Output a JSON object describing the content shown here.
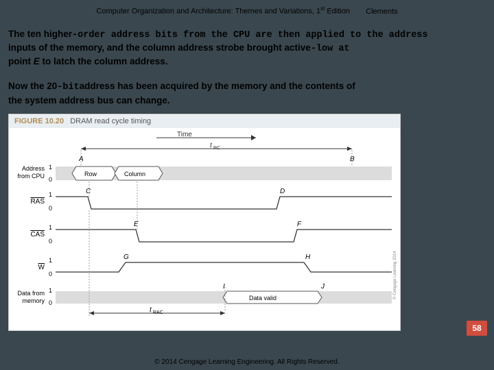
{
  "header": {
    "title_left": "Computer Organization and Architecture: Themes and Variations, 1",
    "title_sup": "st",
    "title_right": " Edition",
    "author": "Clements"
  },
  "para1": {
    "t1": "The ten higher",
    "t2": "-order address bits from the CPU are then applied to the address",
    "t3": "inputs of the memory, and the column address strobe brought active",
    "t4": "-low at",
    "t5": "point ",
    "t6": "E",
    "t7": " to latch the column address."
  },
  "para2": {
    "t1": "Now the 20",
    "t2": "-bit",
    "t3": "address has been acquired by the memory and the contents of",
    "t4": "the system address bus can change."
  },
  "figure": {
    "num": "FIGURE 10.20",
    "title": "DRAM read cycle timing",
    "time_label": "Time",
    "trc": "t",
    "trc_sub": "RC",
    "trac": "t",
    "trac_sub": "RAC",
    "pA": "A",
    "pB": "B",
    "pC": "C",
    "pD": "D",
    "pE": "E",
    "pF": "F",
    "pG": "G",
    "pH": "H",
    "pI": "I",
    "pJ": "J",
    "sig_addr": "Address",
    "sig_from": "from CPU",
    "sig_ras": "RAS",
    "sig_cas": "CAS",
    "sig_w": "W",
    "sig_data": "Data from",
    "sig_mem": "memory",
    "bit1": "1",
    "bit0": "0",
    "row": "Row",
    "col": "Column",
    "valid": "Data valid",
    "copyright": "© Cengage Learning 2014"
  },
  "pagebadge": "58",
  "footer": "© 2014 Cengage Learning Engineering. All Rights Reserved."
}
